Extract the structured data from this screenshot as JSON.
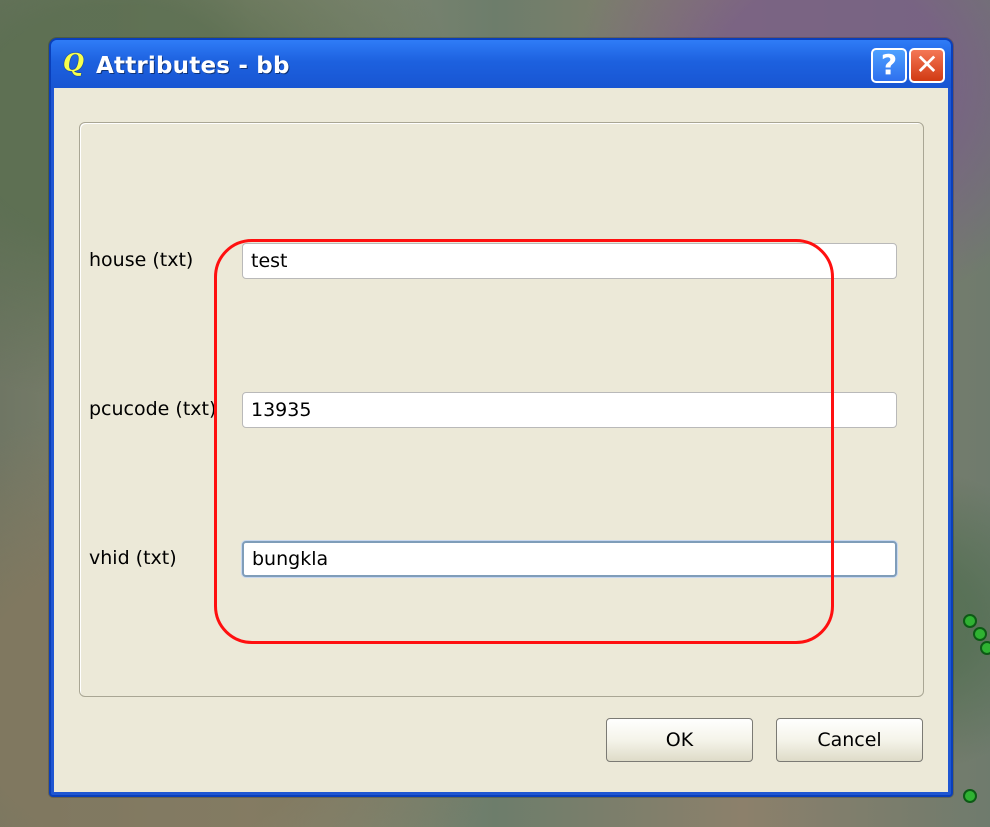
{
  "window": {
    "title": "Attributes - bb",
    "help_label": "?",
    "close_label": "✕",
    "icon_name": "qgis-icon",
    "title_bar_color": "#1d61df"
  },
  "form": {
    "fields": [
      {
        "label": "house (txt)",
        "value": "test",
        "placeholder": ""
      },
      {
        "label": "pcucode (txt)",
        "value": "13935",
        "placeholder": ""
      },
      {
        "label": "vhid (txt)",
        "value": "bungkla",
        "placeholder": ""
      }
    ]
  },
  "buttons": {
    "ok_label": "OK",
    "cancel_label": "Cancel"
  },
  "highlight": {
    "color": "#ff1010"
  }
}
